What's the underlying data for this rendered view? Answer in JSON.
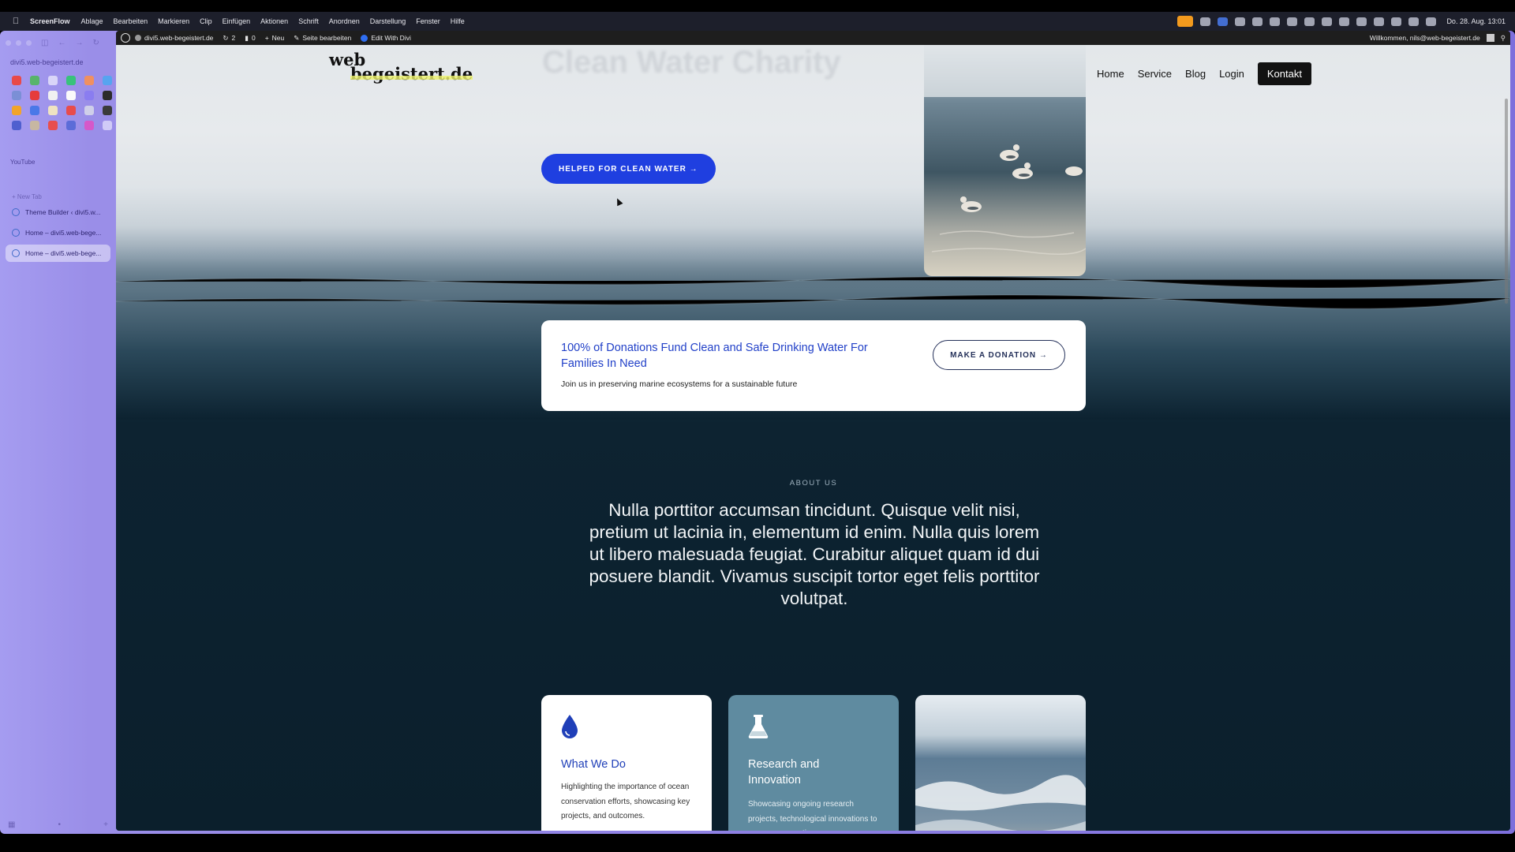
{
  "menubar": {
    "app_name": "ScreenFlow",
    "menus": [
      "Ablage",
      "Bearbeiten",
      "Markieren",
      "Clip",
      "Einfügen",
      "Aktionen",
      "Schrift",
      "Anordnen",
      "Darstellung",
      "Fenster",
      "Hilfe"
    ],
    "clock": "Do. 28. Aug. 13:01"
  },
  "sidebar": {
    "url": "divi5.web-begeistert.de",
    "section_label": "YouTube",
    "new_tab_label": "+ New Tab",
    "tabs": [
      {
        "label": "Theme Builder ‹ divi5.w..."
      },
      {
        "label": "Home – divi5.web-bege..."
      },
      {
        "label": "Home – divi5.web-bege..."
      }
    ]
  },
  "adminbar": {
    "site": "divi5.web-begeistert.de",
    "updates": "2",
    "comments": "0",
    "new_label": "Neu",
    "edit_page": "Seite bearbeiten",
    "edit_divi": "Edit With Divi",
    "welcome": "Willkommen, nils@web-begeistert.de"
  },
  "site": {
    "logo_line1": "web",
    "logo_line2": "begeistert.de",
    "hero_title_faded": "Clean Water Charity",
    "nav": [
      "Home",
      "Service",
      "Blog",
      "Login"
    ],
    "nav_cta": "Kontakt",
    "hero_button": "HELPED FOR CLEAN WATER →",
    "donation": {
      "title": "100% of Donations Fund Clean and Safe Drinking Water For Families In Need",
      "subtitle": "Join us in preserving marine ecosystems for a sustainable future",
      "button": "MAKE A DONATION →"
    },
    "about_label": "ABOUT US",
    "about_text": "Nulla porttitor accumsan tincidunt. Quisque velit nisi, pretium ut lacinia in, elementum id enim. Nulla quis lorem ut libero malesuada feugiat. Curabitur aliquet quam id dui posuere blandit. Vivamus suscipit tortor eget felis porttitor volutpat.",
    "cards": [
      {
        "title": "What We Do",
        "text": "Highlighting the importance of ocean conservation efforts, showcasing key projects, and outcomes.",
        "icon": "water-drop-icon"
      },
      {
        "title": "Research and Innovation",
        "text": "Showcasing ongoing research projects, technological innovations to ocean preservation.",
        "icon": "flask-icon"
      }
    ]
  },
  "colors": {
    "accent_blue": "#1f3fe0",
    "card_teal": "#5f8ba0",
    "dark_navy": "#0b1f2c"
  }
}
